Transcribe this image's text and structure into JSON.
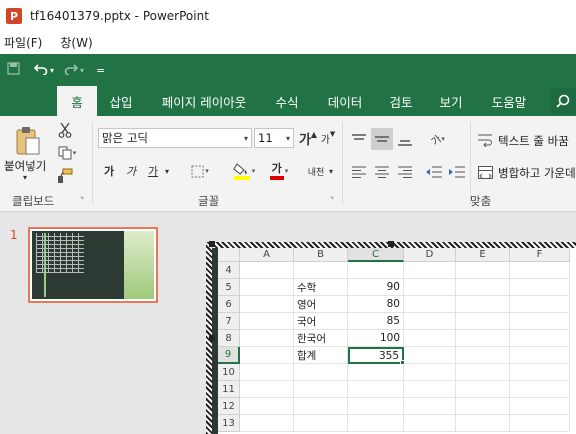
{
  "window": {
    "app_icon": "P",
    "title": "tf16401379.pptx - PowerPoint"
  },
  "menubar": [
    {
      "label": "파일(F)"
    },
    {
      "label": "창(W)"
    }
  ],
  "qat": {
    "icons": [
      "save-icon",
      "undo-icon",
      "redo-icon",
      "customize-icon"
    ]
  },
  "tabs": [
    {
      "label": "홈",
      "active": true
    },
    {
      "label": "삽입"
    },
    {
      "label": "페이지 레이아웃"
    },
    {
      "label": "수식"
    },
    {
      "label": "데이터"
    },
    {
      "label": "검토"
    },
    {
      "label": "보기"
    },
    {
      "label": "도움말"
    }
  ],
  "ribbon": {
    "clipboard": {
      "paste_label": "붙여넣기",
      "group_label": "클립보드"
    },
    "font": {
      "font_name": "맑은 고딕",
      "font_size": "11",
      "grow": "가",
      "shrink": "가",
      "bold": "가",
      "italic": "가",
      "underline": "가",
      "font_color_glyph": "가",
      "phonetic": "내천",
      "group_label": "글꼴"
    },
    "alignment": {
      "wrap_text": "텍스트 줄 바꿈",
      "merge_center": "병합하고 가운데 맞춤",
      "orientation_glyph": "가",
      "group_label": "맞춤"
    },
    "colors": {
      "accent": "#217346",
      "highlight": "#ffff00",
      "font_red": "#e00000"
    }
  },
  "slides_panel": {
    "slide_number": "1"
  },
  "sheet": {
    "columns": [
      "A",
      "B",
      "C",
      "D",
      "E",
      "F"
    ],
    "rows": [
      {
        "num": "4",
        "b": "",
        "c": ""
      },
      {
        "num": "5",
        "b": "수학",
        "c": "90"
      },
      {
        "num": "6",
        "b": "영어",
        "c": "80"
      },
      {
        "num": "7",
        "b": "국어",
        "c": "85"
      },
      {
        "num": "8",
        "b": "한국어",
        "c": "100"
      },
      {
        "num": "9",
        "b": "합계",
        "c": "355"
      },
      {
        "num": "10",
        "b": "",
        "c": ""
      },
      {
        "num": "11",
        "b": "",
        "c": ""
      },
      {
        "num": "12",
        "b": "",
        "c": ""
      },
      {
        "num": "13",
        "b": "",
        "c": ""
      }
    ],
    "selected": {
      "column": "C",
      "row": "9"
    }
  }
}
